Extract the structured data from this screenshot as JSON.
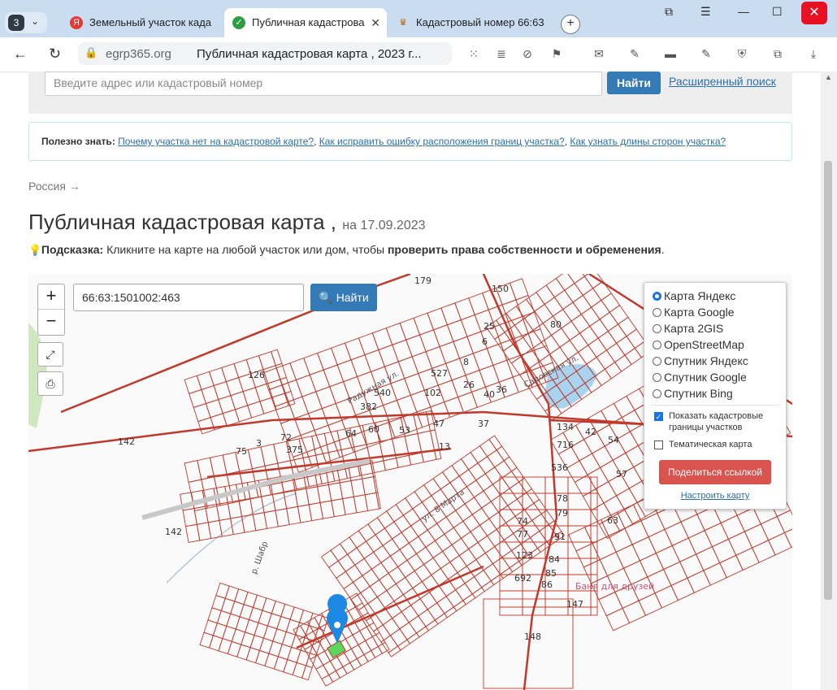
{
  "browser": {
    "tab_count": "3",
    "tabs": [
      {
        "title": "Земельный участок када",
        "icon": "Я"
      },
      {
        "title": "Публичная кадастрова",
        "icon": "✓"
      },
      {
        "title": "Кадастровый номер 66:63",
        "icon": "♛"
      }
    ],
    "url_host": "egrp365.org",
    "page_title": "Публичная кадастровая карта , 2023 г..."
  },
  "page": {
    "search_placeholder": "Введите адрес или кадастровый номер",
    "find_label": "Найти",
    "advanced_search": "Расширенный поиск",
    "info_label": "Полезно знать:",
    "info_links": [
      "Почему участка нет на кадастровой карте?",
      "Как исправить ошибку расположения границ участка?",
      "Как узнать длины сторон участка?"
    ],
    "breadcrumb": "Россия →",
    "title": "Публичная кадастровая карта ,",
    "title_date": "на 17.09.2023",
    "hint_label": "Подсказка:",
    "hint_text": "Кликните на карте на любой участок или дом, чтобы",
    "hint_bold": "проверить права собственности и обременения",
    "hint_end": "."
  },
  "map": {
    "search_value": "66:63:1501002:463",
    "find_label": "Найти",
    "layers": [
      {
        "label": "Карта Яндекс",
        "selected": true
      },
      {
        "label": "Карта Google",
        "selected": false
      },
      {
        "label": "Карта 2GIS",
        "selected": false
      },
      {
        "label": "OpenStreetMap",
        "selected": false
      },
      {
        "label": "Спутник Яндекс",
        "selected": false
      },
      {
        "label": "Спутник Google",
        "selected": false
      },
      {
        "label": "Спутник Bing",
        "selected": false
      }
    ],
    "show_boundaries": "Показать кадастровые границы участков",
    "show_boundaries_checked": true,
    "thematic_map": "Тематическая карта",
    "thematic_checked": false,
    "share_label": "Поделиться ссылкой",
    "configure_label": "Настроить карту",
    "parcel_labels": [
      {
        "text": "126"
      },
      {
        "text": "142"
      },
      {
        "text": "179"
      },
      {
        "text": "150"
      },
      {
        "text": "80"
      },
      {
        "text": "25"
      },
      {
        "text": "6"
      },
      {
        "text": "8"
      },
      {
        "text": "527"
      },
      {
        "text": "102"
      },
      {
        "text": "26"
      },
      {
        "text": "40"
      },
      {
        "text": "36"
      },
      {
        "text": "540"
      },
      {
        "text": "382"
      },
      {
        "text": "60"
      },
      {
        "text": "64"
      },
      {
        "text": "53"
      },
      {
        "text": "47"
      },
      {
        "text": "37"
      },
      {
        "text": "72"
      },
      {
        "text": "375"
      },
      {
        "text": "75"
      },
      {
        "text": "3"
      },
      {
        "text": "13"
      },
      {
        "text": "134"
      },
      {
        "text": "716"
      },
      {
        "text": "42"
      },
      {
        "text": "54"
      },
      {
        "text": "536"
      },
      {
        "text": "57"
      },
      {
        "text": "79"
      },
      {
        "text": "74"
      },
      {
        "text": "77"
      },
      {
        "text": "78"
      },
      {
        "text": "91"
      },
      {
        "text": "63"
      },
      {
        "text": "123"
      },
      {
        "text": "84"
      },
      {
        "text": "85"
      },
      {
        "text": "692"
      },
      {
        "text": "86"
      },
      {
        "text": "147"
      },
      {
        "text": "148"
      },
      {
        "text": "142"
      }
    ],
    "street_labels": [
      {
        "text": "Радужная ул."
      },
      {
        "text": "Садовская ул."
      },
      {
        "text": "ул. 8 Марта"
      },
      {
        "text": "р. Шабр"
      }
    ],
    "poi_label": "Баня для друзей",
    "colors": {
      "cadastre": "#c0392b",
      "water": "#a8d4f0",
      "selected": "#5cd65c",
      "pin": "#1e88e5"
    }
  }
}
